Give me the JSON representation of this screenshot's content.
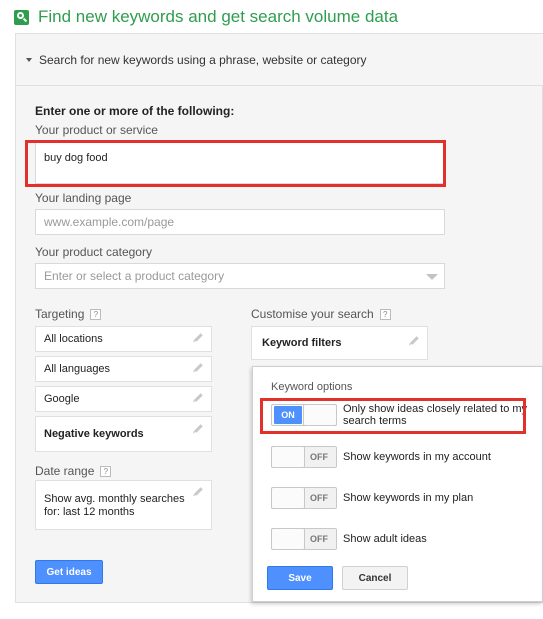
{
  "header": {
    "title": "Find new keywords and get search volume data",
    "icon": "search-icon"
  },
  "panel": {
    "heading": "Search for new keywords using a phrase, website or category",
    "intro": "Enter one or more of the following:",
    "product": {
      "label": "Your product or service",
      "value": "buy dog food"
    },
    "landing": {
      "label": "Your landing page",
      "placeholder": "www.example.com/page"
    },
    "category": {
      "label": "Your product category",
      "placeholder": "Enter or select a product category"
    },
    "targeting": {
      "label": "Targeting",
      "help": "?",
      "rows": [
        "All locations",
        "All languages",
        "Google",
        "Negative keywords"
      ]
    },
    "date_range": {
      "label": "Date range",
      "help": "?",
      "value": "Show avg. monthly searches for: last 12 months"
    },
    "get_ideas_label": "Get ideas",
    "customise": {
      "label": "Customise your search",
      "help": "?",
      "keyword_filters": "Keyword filters"
    }
  },
  "popup": {
    "title": "Keyword options",
    "options": [
      {
        "state": "ON",
        "on": true,
        "label": "Only show ideas closely related to my search terms"
      },
      {
        "state": "OFF",
        "on": false,
        "label": "Show keywords in my account"
      },
      {
        "state": "OFF",
        "on": false,
        "label": "Show keywords in my plan"
      },
      {
        "state": "OFF",
        "on": false,
        "label": "Show adult ideas"
      }
    ],
    "save_label": "Save",
    "cancel_label": "Cancel"
  },
  "colors": {
    "accent_green": "#2e9e4e",
    "button_blue": "#4d90fe",
    "highlight_red": "#e2302a"
  }
}
